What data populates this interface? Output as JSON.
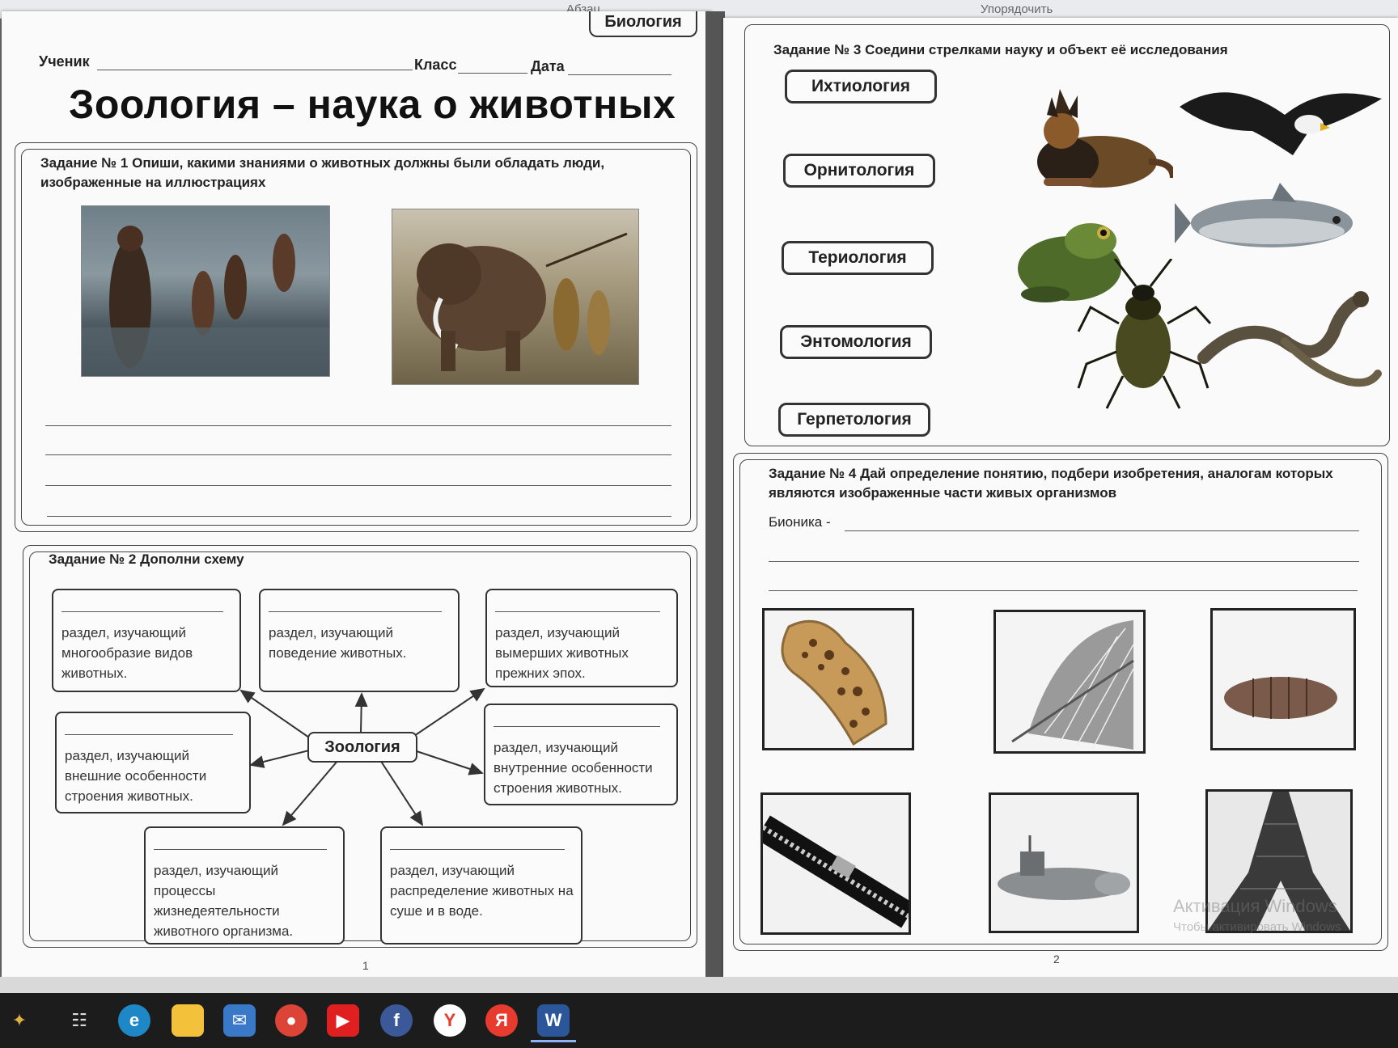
{
  "ribbon": {
    "group1": "Абзац",
    "group2": "Упорядочить"
  },
  "page1": {
    "tag": "Биология",
    "header": {
      "student_label": "Ученик",
      "class_label": "Класс",
      "date_label": "Дата"
    },
    "title": "Зоология – наука о животных",
    "task1": {
      "text": "Задание № 1 Опиши, какими знаниями о животных должны были обладать люди, изображенные на иллюстрациях"
    },
    "task2": {
      "title": "Задание № 2 Дополни схему",
      "center": "Зоология",
      "boxes": [
        "раздел, изучающий многообразие видов животных.",
        "раздел, изучающий поведение животных.",
        "раздел, изучающий вымерших животных прежних эпох.",
        "раздел, изучающий внешние особенности строения животных.",
        "раздел, изучающий внутренние особенности строения животных.",
        "раздел, изучающий процессы жизнедеятельности животного организма.",
        "раздел, изучающий распределение животных на суше и в воде."
      ]
    },
    "page_number": "1"
  },
  "page2": {
    "task3": {
      "title": "Задание № 3 Соедини стрелками науку и объект её исследования",
      "sciences": [
        "Ихтиология",
        "Орнитология",
        "Териология",
        "Энтомология",
        "Герпетология"
      ],
      "animals": [
        "dog",
        "eagle",
        "frog",
        "fish",
        "beetle",
        "lizard"
      ]
    },
    "task4": {
      "title": "Задание № 4 Дай определение понятию, подбери изобретения, аналогам которых являются изображенные части живых организмов",
      "bionics_label": "Бионика -",
      "pictures": [
        "bone",
        "feather",
        "pupa",
        "zipper",
        "submarine",
        "eiffel-tower"
      ]
    },
    "page_number": "2",
    "watermark": "Активация Windows",
    "watermark_sub": "Чтобы активировать Windows"
  },
  "taskbar": {
    "icons": [
      "start-icon",
      "task-view-icon",
      "edge-icon",
      "file-explorer-icon",
      "mail-icon",
      "chrome-icon",
      "youtube-icon",
      "facebook-icon",
      "yandex-browser-icon",
      "yandex-icon",
      "word-icon"
    ],
    "colors": {
      "edge": "#1e88c7",
      "explorer": "#f3c23a",
      "chrome": "#db4437",
      "youtube": "#e02020",
      "facebook": "#3b5998",
      "yandex": "#e63b2e",
      "word": "#2b579a"
    }
  }
}
